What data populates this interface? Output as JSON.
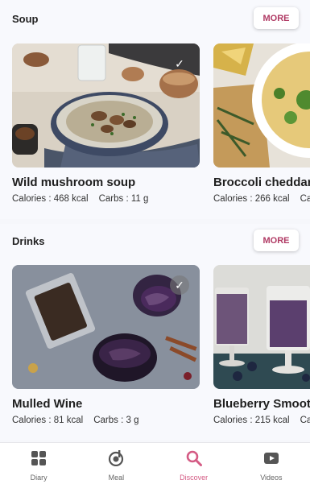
{
  "sections": [
    {
      "title": "Soup",
      "more_label": "MORE",
      "cards": [
        {
          "name": "Wild mushroom soup",
          "calories": "Calories : 468 kcal",
          "carbs": "Carbs : 11 g",
          "checked": true
        },
        {
          "name": "Broccoli cheddar s",
          "calories": "Calories : 266 kcal",
          "carbs": "Ca"
        }
      ]
    },
    {
      "title": "Drinks",
      "more_label": "MORE",
      "cards": [
        {
          "name": "Mulled Wine",
          "calories": "Calories : 81 kcal",
          "carbs": "Carbs : 3 g",
          "checked": true
        },
        {
          "name": "Blueberry Smootho",
          "calories": "Calories : 215 kcal",
          "carbs": "Ca"
        }
      ]
    }
  ],
  "nav": {
    "items": [
      {
        "label": "Diary",
        "icon": "diary-grid-icon"
      },
      {
        "label": "Meal",
        "icon": "meal-icon"
      },
      {
        "label": "Discover",
        "icon": "search-icon",
        "active": true
      },
      {
        "label": "Videos",
        "icon": "play-icon"
      }
    ]
  },
  "colors": {
    "accent": "#d45b84",
    "more_text": "#b03a64"
  }
}
